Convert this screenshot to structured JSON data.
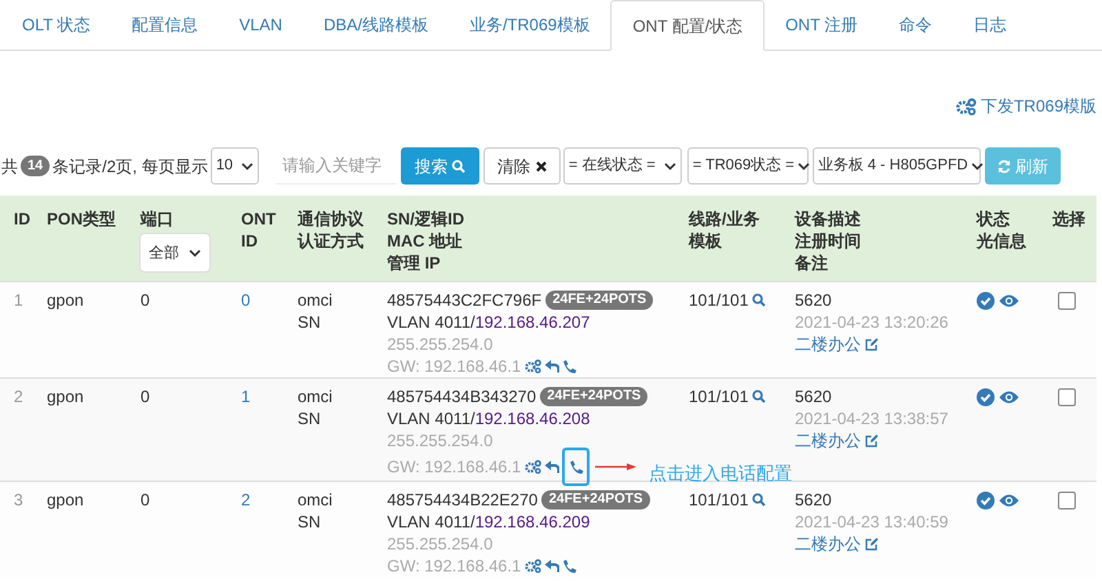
{
  "tabs": [
    {
      "label": "OLT 状态",
      "selected": false
    },
    {
      "label": "配置信息",
      "selected": false
    },
    {
      "label": "VLAN",
      "selected": false
    },
    {
      "label": "DBA/线路模板",
      "selected": false
    },
    {
      "label": "业务/TR069模板",
      "selected": false
    },
    {
      "label": "ONT 配置/状态",
      "selected": true
    },
    {
      "label": "ONT 注册",
      "selected": false
    },
    {
      "label": "命令",
      "selected": false
    },
    {
      "label": "日志",
      "selected": false
    }
  ],
  "push_link": "下发TR069模版",
  "toolbar": {
    "prefix": "共",
    "count": "14",
    "summary": "条记录/2页, 每页显示",
    "page_size": "10",
    "search_placeholder": "请输入关键字",
    "search_button": "搜索",
    "clear_button": "清除",
    "online_filter": "= 在线状态 =",
    "tr069_filter": "= TR069状态 =",
    "board_filter": "业务板 4 - H805GPFD",
    "refresh_button": "刷新"
  },
  "table": {
    "columns": [
      [
        "ID"
      ],
      [
        "PON类型"
      ],
      [
        "端口"
      ],
      [
        "ONT",
        "ID"
      ],
      [
        "通信协议",
        "认证方式"
      ],
      [
        "SN/逻辑ID",
        "MAC 地址",
        "管理 IP"
      ],
      [
        "线路/业务",
        "模板"
      ],
      [
        "设备描述",
        "注册时间",
        "备注"
      ],
      [
        "状态",
        "光信息"
      ],
      [
        "选择"
      ]
    ],
    "port_filter": "全部",
    "rows": [
      {
        "id": "1",
        "pon": "gpon",
        "port": "0",
        "ont_id": "0",
        "protocol": "omci",
        "auth": "SN",
        "sn": "48575443C2FC796F",
        "badge": "24FE+24POTS",
        "vlan": "VLAN 4011/",
        "ip": "192.168.46.207",
        "mask": "255.255.254.0",
        "gw": "GW: 192.168.46.1",
        "template": "101/101",
        "desc": "5620",
        "time": "2021-04-23 13:20:26",
        "note": "二楼办公",
        "online": true,
        "checked": false
      },
      {
        "id": "2",
        "pon": "gpon",
        "port": "0",
        "ont_id": "1",
        "protocol": "omci",
        "auth": "SN",
        "sn": "485754434B343270",
        "badge": "24FE+24POTS",
        "vlan": "VLAN 4011/",
        "ip": "192.168.46.208",
        "mask": "255.255.254.0",
        "gw": "GW: 192.168.46.1",
        "template": "101/101",
        "desc": "5620",
        "time": "2021-04-23 13:38:57",
        "note": "二楼办公",
        "online": true,
        "checked": false,
        "callout": "点击进入电话配置"
      },
      {
        "id": "3",
        "pon": "gpon",
        "port": "0",
        "ont_id": "2",
        "protocol": "omci",
        "auth": "SN",
        "sn": "485754434B22E270",
        "badge": "24FE+24POTS",
        "vlan": "VLAN 4011/",
        "ip": "192.168.46.209",
        "mask": "255.255.254.0",
        "gw": "GW: 192.168.46.1",
        "template": "101/101",
        "desc": "5620",
        "time": "2021-04-23 13:40:59",
        "note": "二楼办公",
        "online": true,
        "checked": false
      }
    ]
  }
}
